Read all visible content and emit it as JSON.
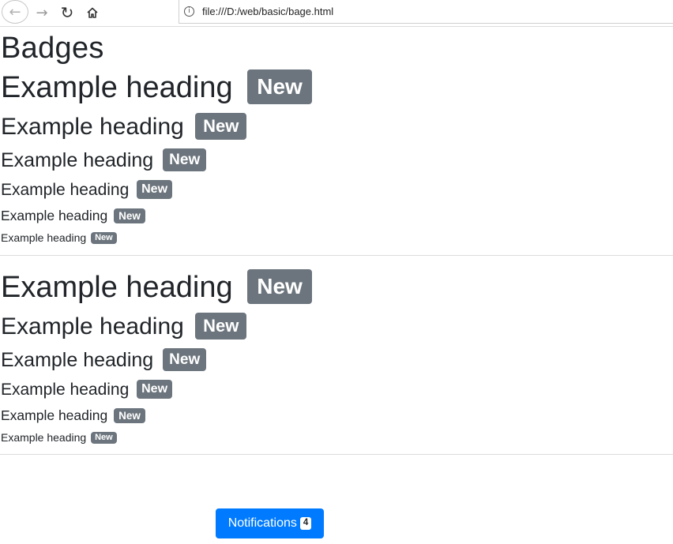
{
  "browser": {
    "url": "file:///D:/web/basic/bage.html"
  },
  "page": {
    "title": "Badges"
  },
  "section1": {
    "headings": [
      {
        "text": "Example heading",
        "badge": "New"
      },
      {
        "text": "Example heading",
        "badge": "New"
      },
      {
        "text": "Example heading",
        "badge": "New"
      },
      {
        "text": "Example heading",
        "badge": "New"
      },
      {
        "text": "Example heading",
        "badge": "New"
      },
      {
        "text": "Example heading",
        "badge": "New"
      }
    ]
  },
  "section2": {
    "headings": [
      {
        "text": "Example heading",
        "badge": "New"
      },
      {
        "text": "Example heading",
        "badge": "New"
      },
      {
        "text": "Example heading",
        "badge": "New"
      },
      {
        "text": "Example heading",
        "badge": "New"
      },
      {
        "text": "Example heading",
        "badge": "New"
      },
      {
        "text": "Example heading",
        "badge": "New"
      }
    ]
  },
  "notifications": {
    "label": "Notifications",
    "count": "4"
  },
  "colors": {
    "badge_secondary": "#6c757d",
    "button_primary": "#007bff"
  }
}
